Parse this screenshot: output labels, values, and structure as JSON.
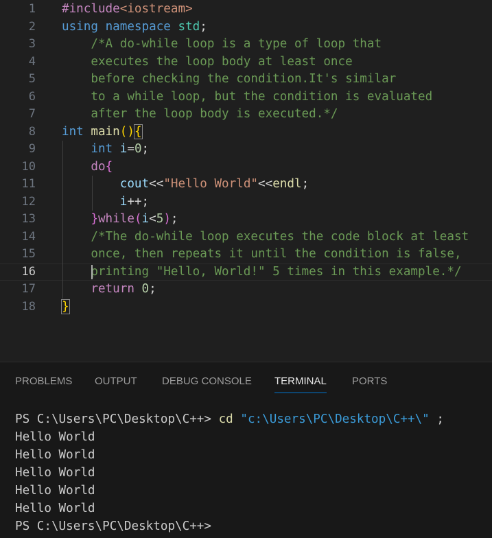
{
  "editor": {
    "active_line": 16,
    "lines": [
      {
        "n": "1",
        "tokens": [
          {
            "c": "inc",
            "t": "#include"
          },
          {
            "c": "str",
            "t": "<iostream>"
          }
        ]
      },
      {
        "n": "2",
        "tokens": [
          {
            "c": "kw",
            "t": "using"
          },
          {
            "c": "op",
            "t": " "
          },
          {
            "c": "kw",
            "t": "namespace"
          },
          {
            "c": "op",
            "t": " "
          },
          {
            "c": "ty",
            "t": "std"
          },
          {
            "c": "op",
            "t": ";"
          }
        ]
      },
      {
        "n": "3",
        "tokens": [
          {
            "c": "cm",
            "t": "    /*A do-while loop is a type of loop that"
          }
        ]
      },
      {
        "n": "4",
        "tokens": [
          {
            "c": "cm",
            "t": "    executes the loop body at least once"
          }
        ]
      },
      {
        "n": "5",
        "tokens": [
          {
            "c": "cm",
            "t": "    before checking the condition.It's similar"
          }
        ]
      },
      {
        "n": "6",
        "tokens": [
          {
            "c": "cm",
            "t": "    to a while loop, but the condition is evaluated"
          }
        ]
      },
      {
        "n": "7",
        "tokens": [
          {
            "c": "cm",
            "t": "    after the loop body is executed.*/"
          }
        ]
      },
      {
        "n": "8",
        "tokens": [
          {
            "c": "kw",
            "t": "int"
          },
          {
            "c": "op",
            "t": " "
          },
          {
            "c": "fn",
            "t": "main"
          },
          {
            "c": "br",
            "t": "()"
          },
          {
            "c": "br bracket-box",
            "t": "{"
          }
        ]
      },
      {
        "n": "9",
        "tokens": [
          {
            "c": "op",
            "t": "    "
          },
          {
            "c": "kw",
            "t": "int"
          },
          {
            "c": "op",
            "t": " "
          },
          {
            "c": "var",
            "t": "i"
          },
          {
            "c": "op",
            "t": "="
          },
          {
            "c": "num",
            "t": "0"
          },
          {
            "c": "op",
            "t": ";"
          }
        ]
      },
      {
        "n": "10",
        "tokens": [
          {
            "c": "op",
            "t": "    "
          },
          {
            "c": "inc",
            "t": "do"
          },
          {
            "c": "br2",
            "t": "{"
          }
        ]
      },
      {
        "n": "11",
        "tokens": [
          {
            "c": "op",
            "t": "        "
          },
          {
            "c": "var",
            "t": "cout"
          },
          {
            "c": "op",
            "t": "<<"
          },
          {
            "c": "str",
            "t": "\"Hello World\""
          },
          {
            "c": "op",
            "t": "<<"
          },
          {
            "c": "fn",
            "t": "endl"
          },
          {
            "c": "op",
            "t": ";"
          }
        ]
      },
      {
        "n": "12",
        "tokens": [
          {
            "c": "op",
            "t": "        "
          },
          {
            "c": "var",
            "t": "i"
          },
          {
            "c": "op",
            "t": "++;"
          }
        ]
      },
      {
        "n": "13",
        "tokens": [
          {
            "c": "op",
            "t": "    "
          },
          {
            "c": "br2",
            "t": "}"
          },
          {
            "c": "inc",
            "t": "while"
          },
          {
            "c": "br2",
            "t": "("
          },
          {
            "c": "var",
            "t": "i"
          },
          {
            "c": "op",
            "t": "<"
          },
          {
            "c": "num",
            "t": "5"
          },
          {
            "c": "br2",
            "t": ")"
          },
          {
            "c": "op",
            "t": ";"
          }
        ]
      },
      {
        "n": "14",
        "tokens": [
          {
            "c": "cm",
            "t": "    /*The do-while loop executes the code block at least"
          }
        ]
      },
      {
        "n": "15",
        "tokens": [
          {
            "c": "cm",
            "t": "    once, then repeats it until the condition is false,"
          }
        ]
      },
      {
        "n": "16",
        "tokens": [
          {
            "c": "cm",
            "t": "    printing \"Hello, World!\" 5 times in this example.*/"
          }
        ]
      },
      {
        "n": "17",
        "tokens": [
          {
            "c": "op",
            "t": "    "
          },
          {
            "c": "inc",
            "t": "return"
          },
          {
            "c": "op",
            "t": " "
          },
          {
            "c": "num",
            "t": "0"
          },
          {
            "c": "op",
            "t": ";"
          }
        ]
      },
      {
        "n": "18",
        "tokens": [
          {
            "c": "br bracket-box",
            "t": "}"
          }
        ]
      }
    ]
  },
  "panel": {
    "tabs": [
      {
        "id": "problems",
        "label": "PROBLEMS",
        "active": false
      },
      {
        "id": "output",
        "label": "OUTPUT",
        "active": false
      },
      {
        "id": "debug-console",
        "label": "DEBUG CONSOLE",
        "active": false
      },
      {
        "id": "terminal",
        "label": "TERMINAL",
        "active": true
      },
      {
        "id": "ports",
        "label": "PORTS",
        "active": false
      }
    ],
    "terminal": {
      "prompt": "PS C:\\Users\\PC\\Desktop\\C++> ",
      "command": "cd",
      "argument": "\"c:\\Users\\PC\\Desktop\\C++\\\"",
      "suffix": " ;",
      "output": [
        "Hello World",
        "Hello World",
        "Hello World",
        "Hello World",
        "Hello World"
      ],
      "final_prompt": "PS C:\\Users\\PC\\Desktop\\C++>"
    }
  },
  "colors": {
    "background": "#1f1f1f",
    "panel_background": "#181818",
    "accent": "#0078d4",
    "comment": "#6a9955",
    "keyword": "#569cd6"
  }
}
